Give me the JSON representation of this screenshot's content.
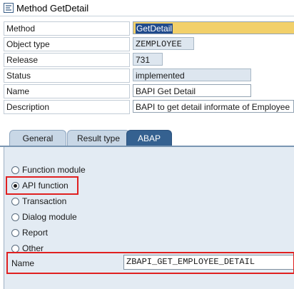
{
  "window": {
    "title": "Method GetDetail",
    "icon": "method-icon"
  },
  "fields": [
    {
      "label": "Method",
      "value": "GetDetail"
    },
    {
      "label": "Object type",
      "value": "ZEMPLOYEE"
    },
    {
      "label": "Release",
      "value": "731"
    },
    {
      "label": "Status",
      "value": "implemented"
    },
    {
      "label": "Name",
      "value": "BAPI Get Detail"
    },
    {
      "label": "Description",
      "value": "BAPI to get detail informate of Employee"
    }
  ],
  "tabs": [
    {
      "label": "General",
      "active": false
    },
    {
      "label": "Result type",
      "active": false
    },
    {
      "label": "ABAP",
      "active": true
    }
  ],
  "radios": [
    {
      "label": "Function module",
      "selected": false
    },
    {
      "label": "API function",
      "selected": true
    },
    {
      "label": "Transaction",
      "selected": false
    },
    {
      "label": "Dialog module",
      "selected": false
    },
    {
      "label": "Report",
      "selected": false
    },
    {
      "label": "Other",
      "selected": false
    }
  ],
  "name_field": {
    "label": "Name",
    "value": "ZBAPI_GET_EMPLOYEE_DETAIL"
  },
  "colors": {
    "highlight": "#e02020",
    "active_tab": "#356190",
    "panel_bg": "#e3ebf3"
  }
}
